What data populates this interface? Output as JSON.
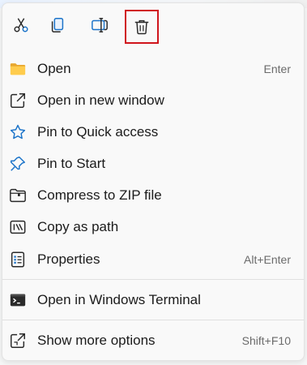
{
  "toolbar": {
    "cut_icon": "scissors-icon",
    "copy_icon": "copy-icon",
    "rename_icon": "rename-icon",
    "delete_icon": "trash-icon",
    "highlight_color": "#d0151c"
  },
  "menu": {
    "items": [
      {
        "label": "Open",
        "accel": "Enter",
        "icon": "folder-icon"
      },
      {
        "label": "Open in new window",
        "accel": "",
        "icon": "open-in-new-window-icon"
      },
      {
        "label": "Pin to Quick access",
        "accel": "",
        "icon": "star-icon"
      },
      {
        "label": "Pin to Start",
        "accel": "",
        "icon": "pin-icon"
      },
      {
        "label": "Compress to ZIP file",
        "accel": "",
        "icon": "zip-folder-icon"
      },
      {
        "label": "Copy as path",
        "accel": "",
        "icon": "path-icon"
      },
      {
        "label": "Properties",
        "accel": "Alt+Enter",
        "icon": "properties-icon"
      },
      {
        "label": "Open in Windows Terminal",
        "accel": "",
        "icon": "terminal-icon"
      },
      {
        "label": "Show more options",
        "accel": "Shift+F10",
        "icon": "more-options-icon"
      }
    ]
  }
}
